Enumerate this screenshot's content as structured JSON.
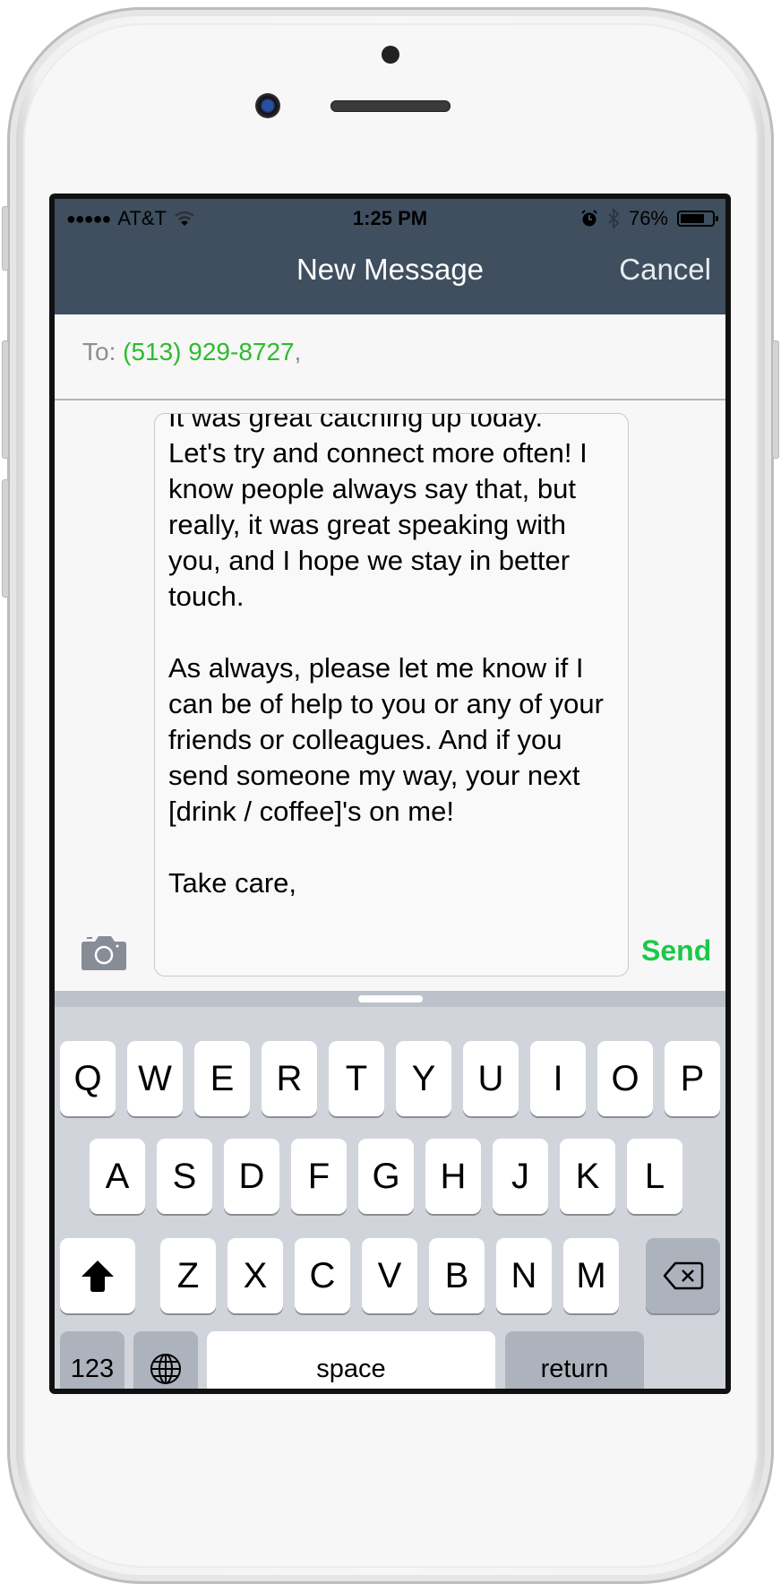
{
  "status_bar": {
    "signal": "●●●●●",
    "carrier": "AT&T",
    "time": "1:25 PM",
    "battery_percent_label": "76%",
    "battery_level": 0.76
  },
  "nav": {
    "title": "New Message",
    "cancel_label": "Cancel"
  },
  "to_field": {
    "label": "To:",
    "recipient": "(513) 929-8727",
    "separator": ","
  },
  "message": {
    "text": "It was great catching up today.\nLet's try and connect more often! I know people always say that, but really, it was great speaking with you, and I hope we stay in better touch.\n\nAs always, please let me know if I can be of help to you or any of your friends or colleagues. And if you send someone my way, your next [drink / coffee]'s on me!\n\nTake care,"
  },
  "compose": {
    "send_label": "Send"
  },
  "keyboard": {
    "row1": [
      "Q",
      "W",
      "E",
      "R",
      "T",
      "Y",
      "U",
      "I",
      "O",
      "P"
    ],
    "row2": [
      "A",
      "S",
      "D",
      "F",
      "G",
      "H",
      "J",
      "K",
      "L"
    ],
    "row3": [
      "Z",
      "X",
      "C",
      "V",
      "B",
      "N",
      "M"
    ],
    "numbers_label": "123",
    "space_label": "space",
    "return_label": "return"
  },
  "colors": {
    "header": "#3f4f5f",
    "recipient_green": "#2dbb2d",
    "send_green": "#1bc84a"
  }
}
